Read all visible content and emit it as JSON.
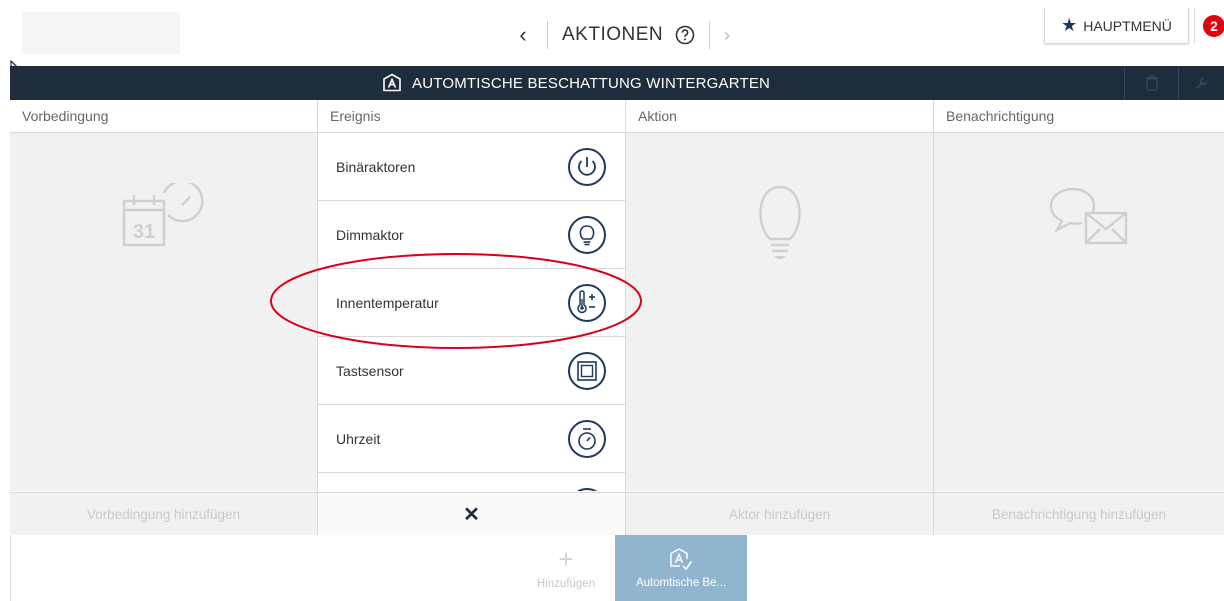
{
  "topbar": {
    "nav_prev": "‹",
    "title": "AKTIONEN",
    "nav_next": "›",
    "main_menu_label": "HAUPTMENÜ",
    "notification_count": "2"
  },
  "header": {
    "title": "AUTOMTISCHE BESCHATTUNG WINTERGARTEN"
  },
  "columns": {
    "precondition": {
      "label": "Vorbedingung",
      "add_label": "Vorbedingung hinzufügen",
      "icon": "calendar-clock-icon"
    },
    "event": {
      "label": "Ereignis",
      "close_label": "✕",
      "items": [
        {
          "label": "Binäraktoren",
          "icon": "power-icon"
        },
        {
          "label": "Dimmaktor",
          "icon": "bulb-icon"
        },
        {
          "label": "Innentemperatur",
          "icon": "thermometer-icon"
        },
        {
          "label": "Tastsensor",
          "icon": "button-sensor-icon"
        },
        {
          "label": "Uhrzeit",
          "icon": "stopwatch-icon"
        }
      ]
    },
    "action": {
      "label": "Aktion",
      "add_label": "Aktor hinzufügen",
      "icon": "lightbulb-icon"
    },
    "notification": {
      "label": "Benachrichtigung",
      "add_label": "Benachrichtigung hinzufügen",
      "icon": "message-envelope-icon"
    }
  },
  "bottom": {
    "add_label": "Hinzufügen",
    "plus": "+",
    "rule_tab_label": "Automtische Be..."
  },
  "colors": {
    "header_bg": "#1e2c3c",
    "icon_navy": "#1e3a5a",
    "badge_red": "#e3000f",
    "active_tab": "#91b4cf",
    "annotation_red": "#d9001b"
  }
}
